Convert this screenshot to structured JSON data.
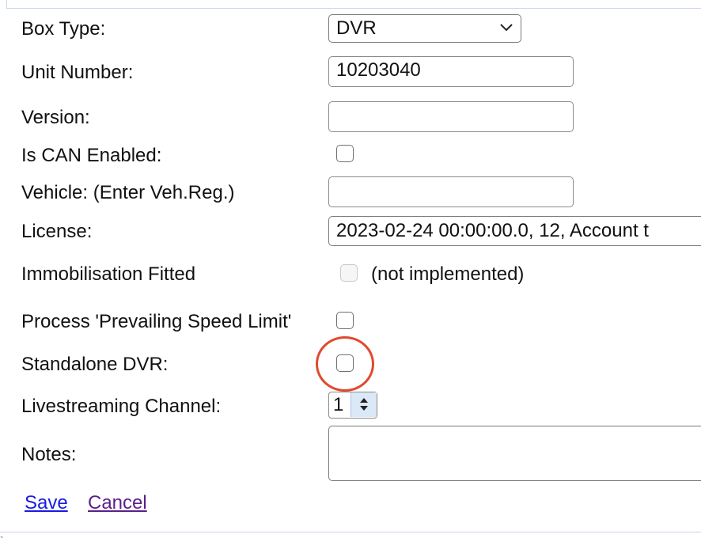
{
  "form": {
    "box_type": {
      "label": "Box Type:",
      "value": "DVR"
    },
    "unit_number": {
      "label": "Unit Number:",
      "value": "10203040"
    },
    "version": {
      "label": "Version:",
      "value": ""
    },
    "is_can_enabled": {
      "label": "Is CAN Enabled:",
      "checked": false
    },
    "vehicle": {
      "label": "Vehicle: (Enter Veh.Reg.)",
      "value": ""
    },
    "license": {
      "label": "License:",
      "value": "2023-02-24 00:00:00.0, 12, Account t"
    },
    "immobilisation": {
      "label": "Immobilisation Fitted",
      "checked": false,
      "disabled": true,
      "note": "(not implemented)"
    },
    "prevailing_speed": {
      "label": "Process 'Prevailing Speed Limit'",
      "checked": false
    },
    "standalone_dvr": {
      "label": "Standalone DVR:",
      "checked": false
    },
    "livestreaming": {
      "label": "Livestreaming Channel:",
      "value": "1"
    },
    "notes": {
      "label": "Notes:",
      "value": ""
    }
  },
  "actions": {
    "save_label": "Save",
    "cancel_label": "Cancel"
  },
  "colors": {
    "highlight": "#e2492e",
    "link": "#1a1ae6",
    "visited_link": "#5b1f8a"
  }
}
